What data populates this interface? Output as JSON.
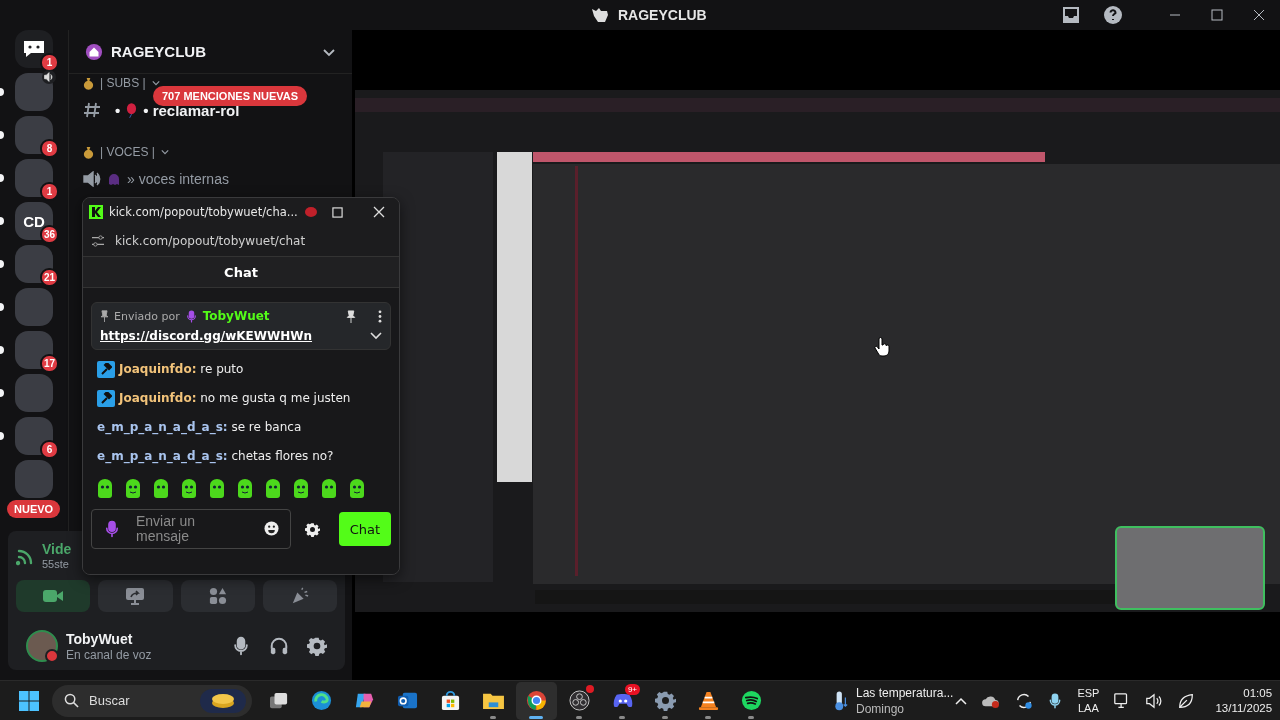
{
  "window": {
    "title": "RAGEYCLUB"
  },
  "servers": [
    {
      "kind": "dm",
      "badge": "1",
      "unread": false,
      "speaking": false
    },
    {
      "kind": "server",
      "unread": true,
      "speaking": true
    },
    {
      "kind": "server",
      "badge": "8",
      "unread": true,
      "speaking": false
    },
    {
      "kind": "server",
      "badge": "1",
      "unread": true,
      "speaking": false
    },
    {
      "kind": "server",
      "label": "CD",
      "badge": "36",
      "unread": true,
      "speaking": false
    },
    {
      "kind": "server",
      "badge": "21",
      "unread": true,
      "speaking": false
    },
    {
      "kind": "server",
      "unread": true,
      "speaking": false
    },
    {
      "kind": "server",
      "badge": "17",
      "unread": true,
      "speaking": false
    },
    {
      "kind": "server",
      "unread": true,
      "speaking": false
    },
    {
      "kind": "server",
      "badge": "6",
      "unread": true,
      "speaking": false
    },
    {
      "kind": "server",
      "unread": false,
      "speaking": false
    }
  ],
  "new_server_label": "NUEVO",
  "server": {
    "name": "RAGEYCLUB",
    "mentions_pill": "707 MENCIONES NUEVAS",
    "channels": [
      {
        "kind": "category",
        "name": "| SUBS |"
      },
      {
        "kind": "text",
        "decor": "•",
        "name": "• reclamar-rol"
      },
      {
        "kind": "category",
        "name": "| VOCES |"
      },
      {
        "kind": "voice",
        "name": "» voces internas"
      }
    ]
  },
  "voice_panel": {
    "title": "Vide",
    "subtitle": "55ste",
    "buttons": [
      {
        "on": true
      },
      {
        "on": false
      },
      {
        "on": false
      },
      {
        "on": false
      }
    ]
  },
  "user": {
    "name": "TobyWuet",
    "status": "En canal de voz"
  },
  "popup": {
    "title": "kick.com/popout/tobywuet/cha...",
    "url": "kick.com/popout/tobywuet/chat",
    "header": "Chat",
    "pinned": {
      "label": "Enviado por",
      "user": "TobyWuet",
      "link": "https://discord.gg/wKEWWHWn"
    },
    "messages": [
      {
        "user": "Joaquinfdo:",
        "text": "re puto",
        "color": "#f2c37a",
        "badge": true
      },
      {
        "user": "Joaquinfdo:",
        "text": "no me gusta q me justen",
        "color": "#f2c37a",
        "badge": true
      },
      {
        "user": "e_m_p_a_n_a_d_a_s:",
        "text": "se re banca",
        "color": "#a9c4ee",
        "badge": false
      },
      {
        "user": "e_m_p_a_n_a_d_a_s:",
        "text": "chetas flores no?",
        "color": "#a9c4ee",
        "badge": false
      }
    ],
    "placeholder": "Enviar un mensaje",
    "send": "Chat"
  },
  "taskbar": {
    "search_placeholder": "Buscar",
    "apps": [
      {
        "running": false,
        "active": false,
        "alert": false
      },
      {
        "running": false,
        "active": false,
        "alert": false
      },
      {
        "running": false,
        "active": false,
        "alert": false
      },
      {
        "running": false,
        "active": false,
        "alert": false
      },
      {
        "running": false,
        "active": false,
        "alert": false
      },
      {
        "running": true,
        "active": false,
        "alert": false
      },
      {
        "running": true,
        "active": true,
        "alert": false
      },
      {
        "running": true,
        "active": false,
        "alert": true
      },
      {
        "running": true,
        "active": false,
        "alert": false,
        "badge": "9+"
      },
      {
        "running": true,
        "active": false,
        "alert": false
      },
      {
        "running": true,
        "active": false,
        "alert": false
      },
      {
        "running": true,
        "active": false,
        "alert": false
      }
    ],
    "widget": {
      "title": "Las temperatura...",
      "subtitle": "Domingo"
    },
    "language": "ESP",
    "region": "LAA",
    "time": "01:05",
    "date": "13/11/2025"
  }
}
